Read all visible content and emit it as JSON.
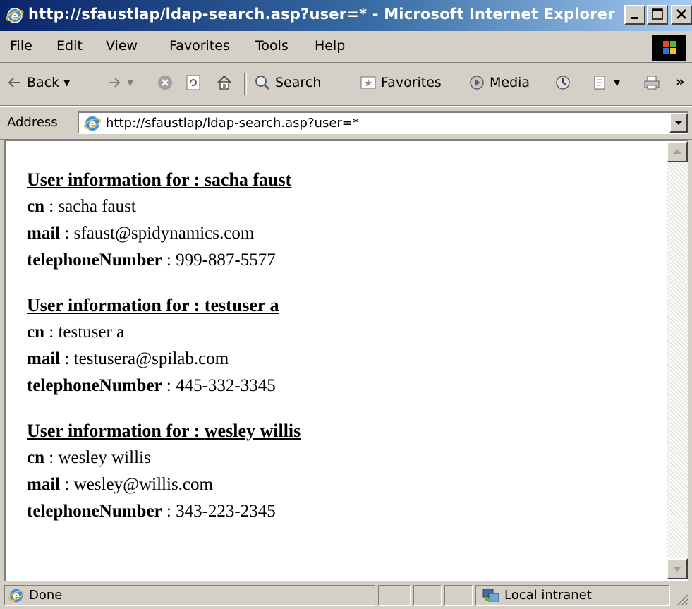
{
  "window": {
    "title": "http://sfaustlap/ldap-search.asp?user=* - Microsoft Internet Explorer"
  },
  "menu": {
    "items": [
      "File",
      "Edit",
      "View",
      "Favorites",
      "Tools",
      "Help"
    ]
  },
  "toolbar": {
    "back_label": "Back",
    "search_label": "Search",
    "favorites_label": "Favorites",
    "media_label": "Media",
    "more_label": "»"
  },
  "address": {
    "label": "Address",
    "url": "http://sfaustlap/ldap-search.asp?user=*"
  },
  "page": {
    "heading_prefix": "User information for : ",
    "users": [
      {
        "name": "sacha faust",
        "cn_label": "cn",
        "cn": "sacha faust",
        "mail_label": "mail",
        "mail": "sfaust@spidynamics.com",
        "phone_label": "telephoneNumber",
        "phone": "999-887-5577"
      },
      {
        "name": "testuser a",
        "cn_label": "cn",
        "cn": "testuser a",
        "mail_label": "mail",
        "mail": "testusera@spilab.com",
        "phone_label": "telephoneNumber",
        "phone": "445-332-3345"
      },
      {
        "name": "wesley willis",
        "cn_label": "cn",
        "cn": "wesley willis",
        "mail_label": "mail",
        "mail": "wesley@willis.com",
        "phone_label": "telephoneNumber",
        "phone": "343-223-2345"
      }
    ],
    "separator": " : "
  },
  "status": {
    "text": "Done",
    "zone": "Local intranet"
  },
  "colors": {
    "titlebar_start": "#0a246a",
    "titlebar_end": "#a6caf0",
    "chrome": "#d4d0c8"
  }
}
